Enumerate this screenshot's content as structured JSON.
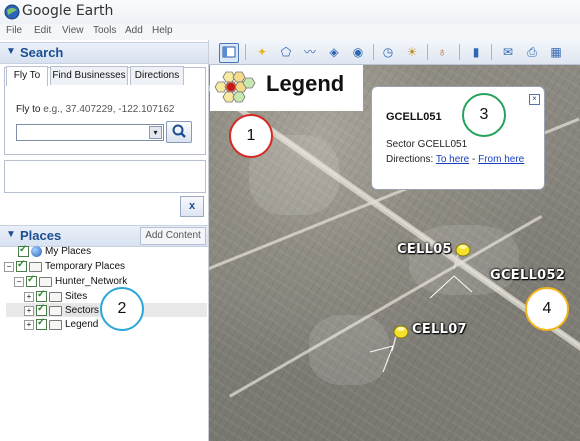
{
  "window": {
    "title": "Google Earth"
  },
  "menu": [
    "File",
    "Edit",
    "View",
    "Tools",
    "Add",
    "Help"
  ],
  "search": {
    "header": "Search",
    "tabs": [
      "Fly To",
      "Find Businesses",
      "Directions"
    ],
    "flyto_prefix": "Fly to ",
    "flyto_hint": "e.g., 37.407229, -122.107162",
    "input_value": "",
    "close_label": "x"
  },
  "places": {
    "header": "Places",
    "add_content": "Add Content",
    "items": [
      {
        "label": "My Places"
      },
      {
        "label": "Temporary Places"
      },
      {
        "label": "Hunter_Network"
      },
      {
        "label": "Sites"
      },
      {
        "label": "Sectors"
      },
      {
        "label": "Legend"
      }
    ]
  },
  "map": {
    "legend_title": "Legend",
    "balloon": {
      "title": "GCELL051",
      "description": "Sector GCELL051",
      "directions_prefix": "Directions: ",
      "link_to_here": "To here",
      "separator": " - ",
      "link_from_here": "From here"
    },
    "labels": [
      "CELL05",
      "GCELL052",
      "CELL07"
    ],
    "callouts": [
      "1",
      "2",
      "3",
      "4"
    ]
  },
  "colors": {
    "callout_1": "#d42a25",
    "callout_2": "#2aa7d8",
    "callout_3": "#25a35a",
    "callout_4": "#f2b51c",
    "pin": "#f3e12a"
  }
}
